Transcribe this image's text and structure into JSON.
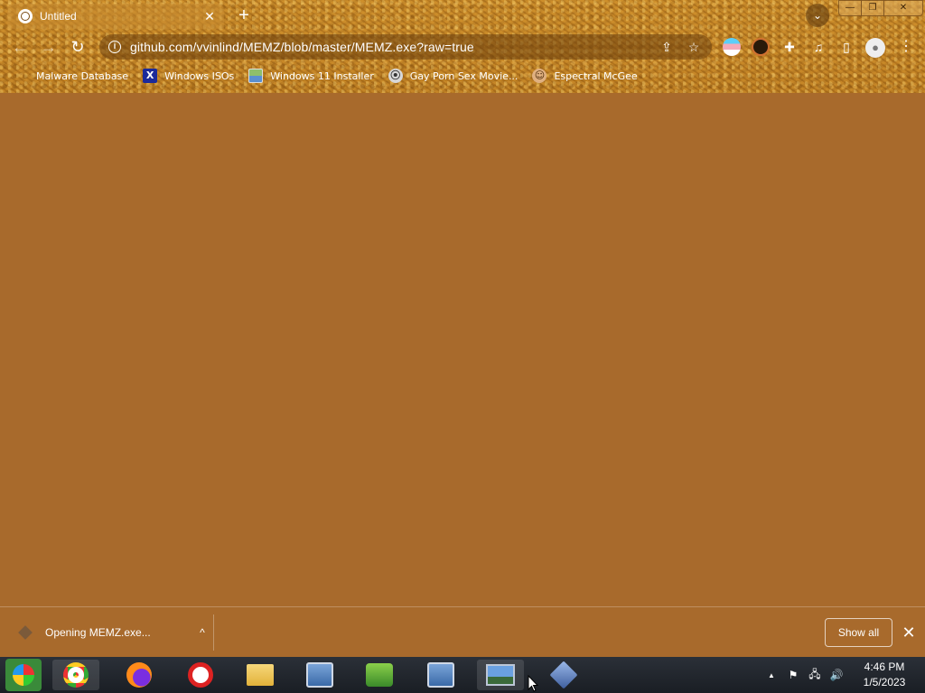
{
  "tab": {
    "title": "Untitled",
    "close": "✕"
  },
  "new_tab": "+",
  "window_controls": {
    "minimize": "—",
    "maximize": "❐",
    "close": "✕"
  },
  "nav": {
    "back": "←",
    "forward": "→",
    "reload": "↻"
  },
  "omnibox": {
    "info": "i",
    "url": "github.com/vvinlind/MEMZ/blob/master/MEMZ.exe?raw=true"
  },
  "bookmarks": [
    {
      "label": "Malware Database",
      "icon": "blank-icon",
      "glyph": ""
    },
    {
      "label": "Windows ISOs",
      "icon": "x-logo-icon",
      "glyph": "X"
    },
    {
      "label": "Windows 11 Installer",
      "icon": "picture-icon",
      "glyph": ""
    },
    {
      "label": "Gay Porn Sex Movie...",
      "icon": "film-reel-icon",
      "glyph": "⦿"
    },
    {
      "label": "Espectral McGee",
      "icon": "face-icon",
      "glyph": "☺"
    }
  ],
  "download": {
    "label": "Opening MEMZ.exe...",
    "chevron": "^",
    "show_all": "Show all",
    "close": "✕"
  },
  "taskbar": {
    "apps": [
      "start-orb",
      "chrome",
      "firefox",
      "opera",
      "file-explorer",
      "installer",
      "contacts",
      "installer-2",
      "photo-viewer",
      "unknown-app"
    ],
    "clock_time": "4:46 PM",
    "clock_date": "1/5/2023",
    "tray": {
      "show_hidden": "▲",
      "flag": "⚑",
      "network": "🖧",
      "volume": "🔊"
    }
  },
  "colors": {
    "page_background": "#a86a2c",
    "taskbar": "#1f242b"
  }
}
